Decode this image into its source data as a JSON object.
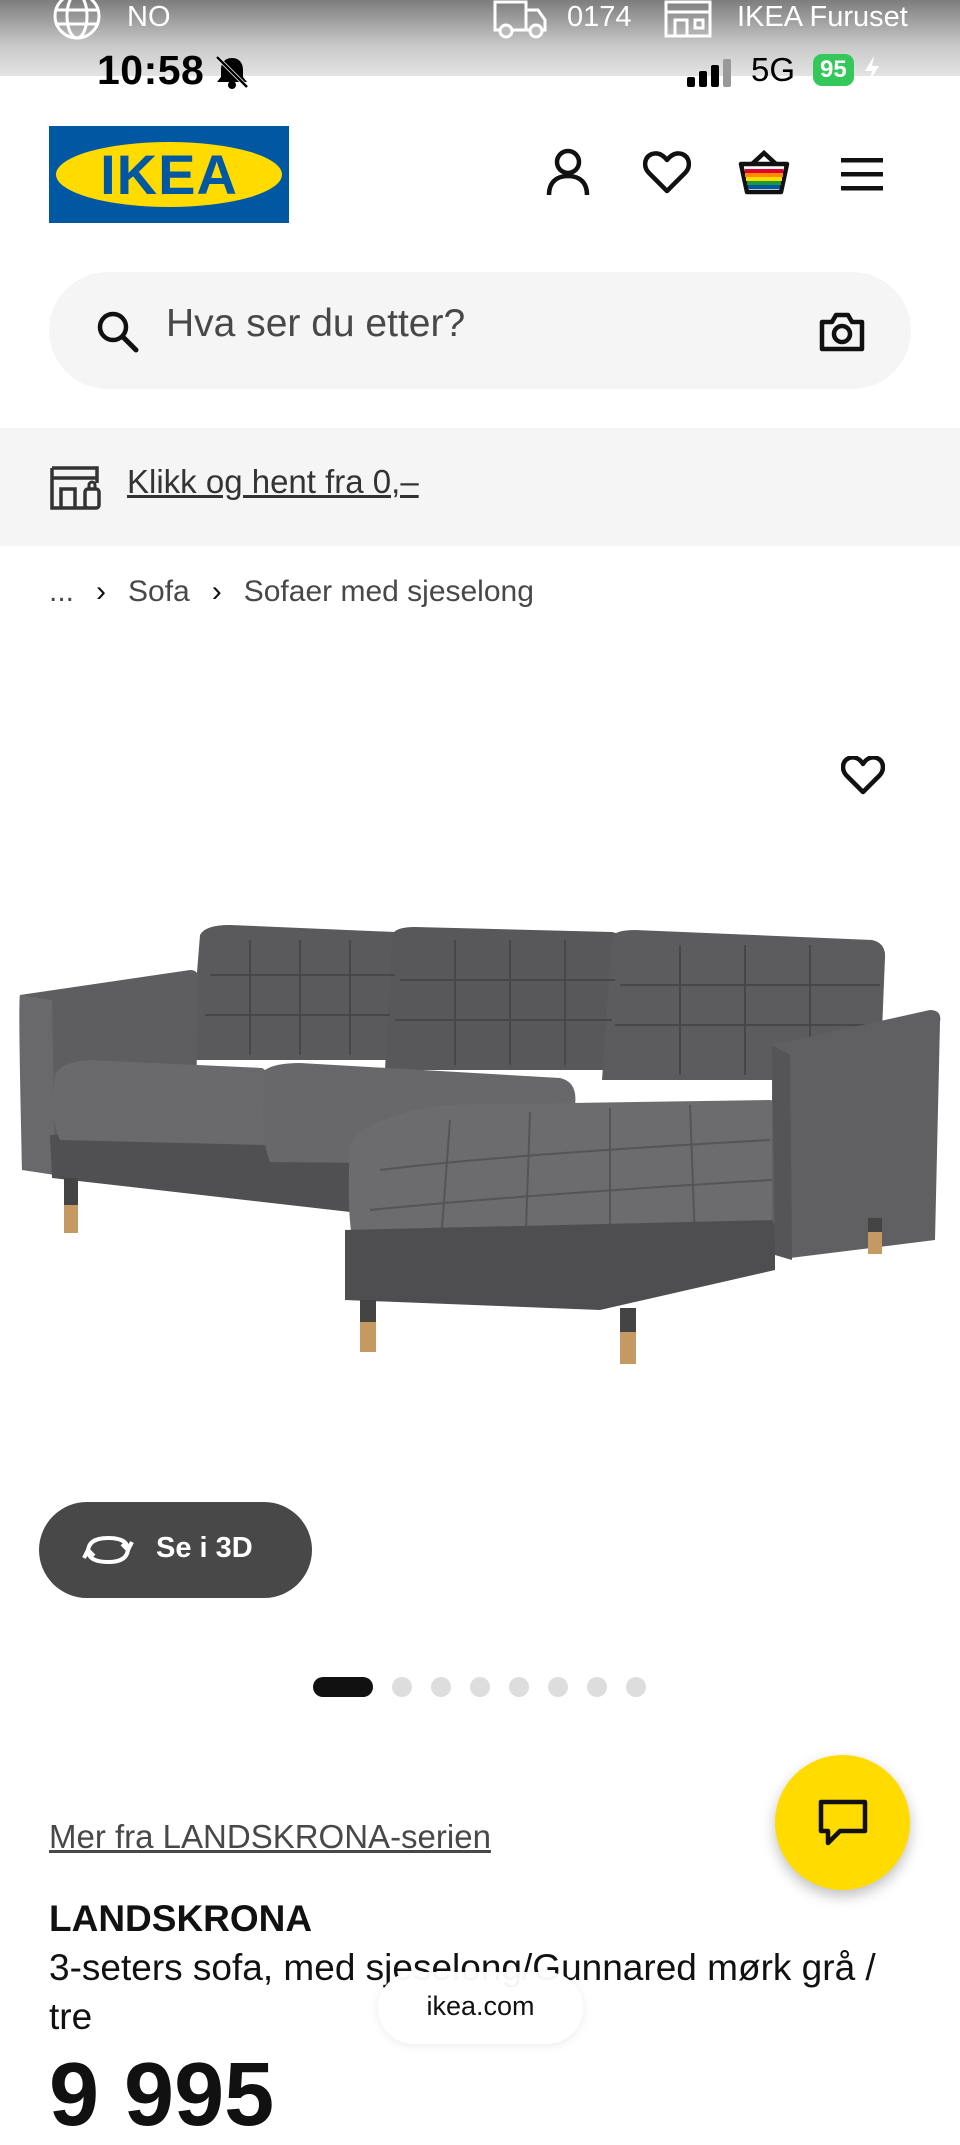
{
  "top_strip": {
    "country": "NO",
    "postal_code": "0174",
    "store": "IKEA Furuset"
  },
  "status_bar": {
    "time": "10:58",
    "network": "5G",
    "battery": "95"
  },
  "header": {
    "logo_text": "IKEA",
    "icons": [
      "account-icon",
      "heart-icon",
      "basket-icon",
      "menu-icon"
    ]
  },
  "search": {
    "placeholder": "Hva ser du etter?"
  },
  "click_collect": {
    "label": "Klikk og hent fra 0,–"
  },
  "breadcrumb": {
    "ellipsis": "...",
    "items": [
      "Sofa",
      "Sofaer med sjeselong"
    ]
  },
  "product": {
    "view_3d_label": "Se i 3D",
    "image_count": 8,
    "active_image": 1,
    "series_link": "Mer fra LANDSKRONA-serien",
    "name": "LANDSKRONA",
    "description": "3-seters sofa, med sjeselong/Gunnared mørk grå / tre",
    "price_partial": "9 995"
  },
  "browser": {
    "url": "ikea.com"
  },
  "colors": {
    "ikea_blue": "#0058a3",
    "ikea_yellow": "#ffdb00",
    "battery_green": "#34c759"
  }
}
